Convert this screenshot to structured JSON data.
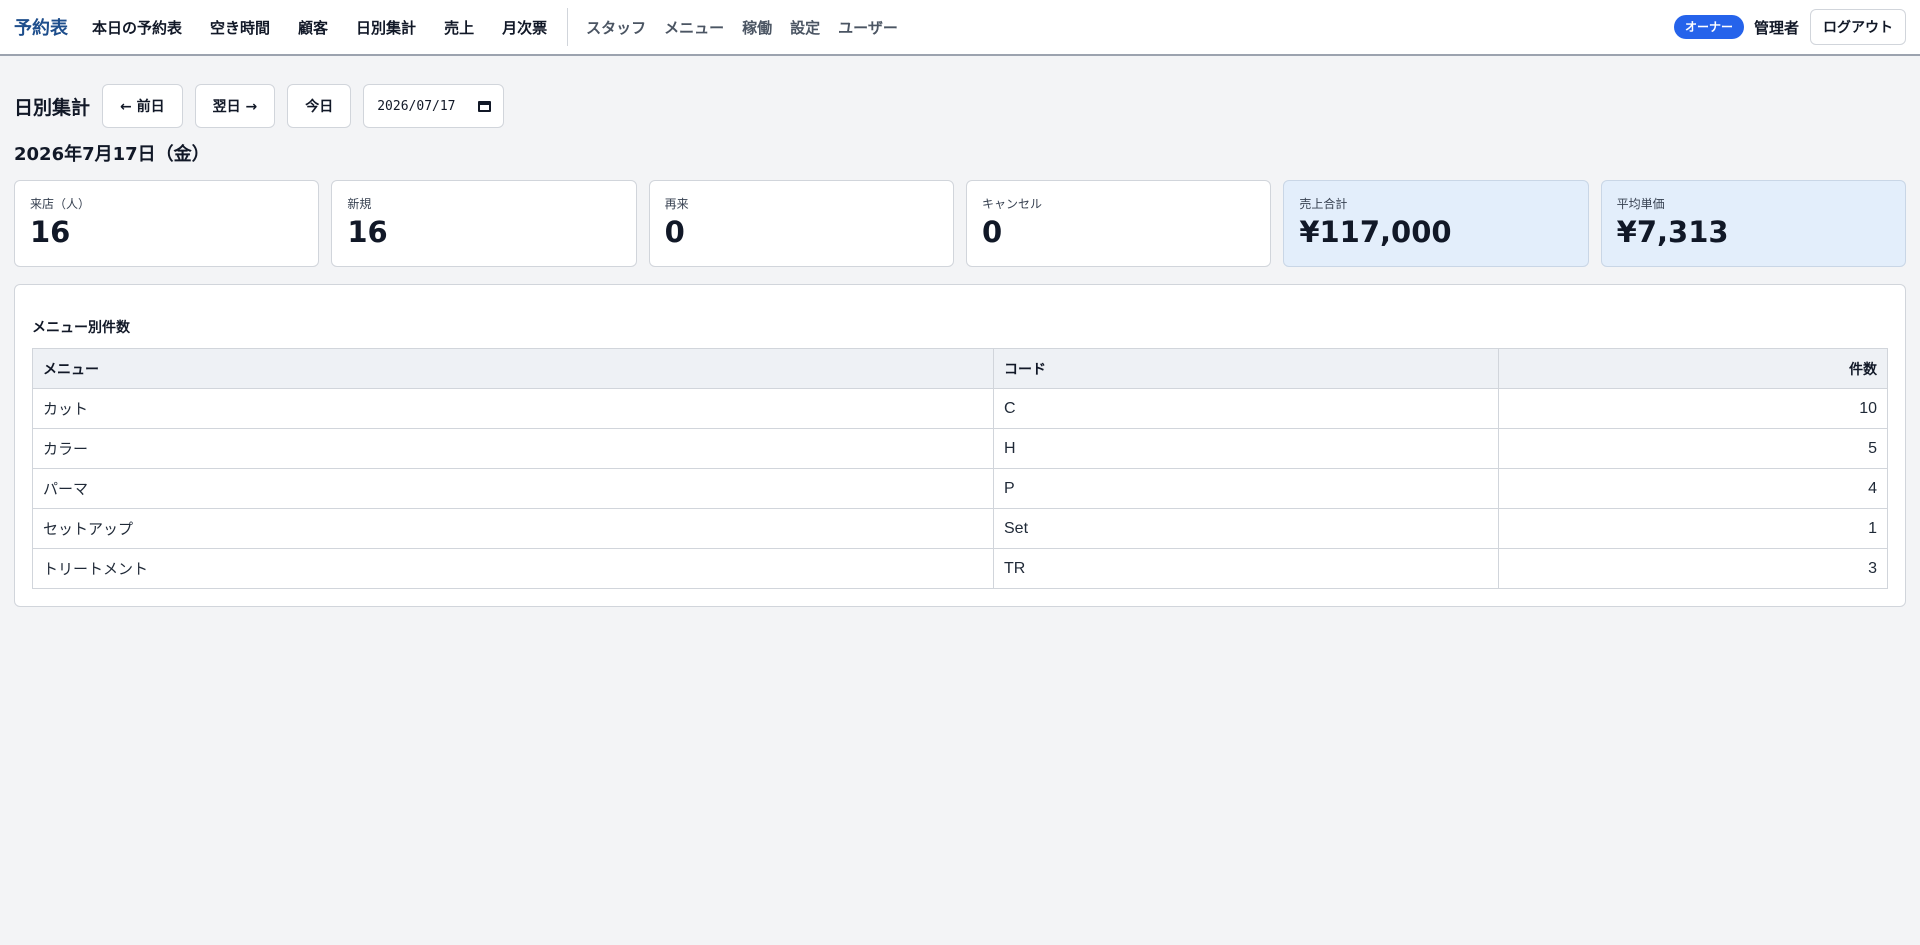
{
  "nav": {
    "brand": "予約表",
    "main_items": [
      {
        "label": "本日の予約表"
      },
      {
        "label": "空き時間"
      },
      {
        "label": "顧客"
      },
      {
        "label": "日別集計"
      },
      {
        "label": "売上"
      },
      {
        "label": "月次票"
      }
    ],
    "admin_items": [
      {
        "label": "スタッフ"
      },
      {
        "label": "メニュー"
      },
      {
        "label": "稼働"
      },
      {
        "label": "設定"
      },
      {
        "label": "ユーザー"
      }
    ],
    "role_badge": "オーナー",
    "user_name": "管理者",
    "logout_label": "ログアウト"
  },
  "toolbar": {
    "title": "日別集計",
    "prev_label": "← 前日",
    "next_label": "翌日 →",
    "today_label": "今日",
    "date_value": "2026/07/17"
  },
  "date_heading": "2026年7月17日（金）",
  "stats": [
    {
      "label": "来店（人）",
      "value": "16"
    },
    {
      "label": "新規",
      "value": "16"
    },
    {
      "label": "再来",
      "value": "0"
    },
    {
      "label": "キャンセル",
      "value": "0"
    },
    {
      "label": "売上合計",
      "value": "¥117,000"
    },
    {
      "label": "平均単価",
      "value": "¥7,313"
    }
  ],
  "menu_table": {
    "title": "メニュー別件数",
    "headers": {
      "menu": "メニュー",
      "code": "コード",
      "count": "件数"
    },
    "rows": [
      {
        "menu": "カット",
        "code": "C",
        "count": "10"
      },
      {
        "menu": "カラー",
        "code": "H",
        "count": "5"
      },
      {
        "menu": "パーマ",
        "code": "P",
        "count": "4"
      },
      {
        "menu": "セットアップ",
        "code": "Set",
        "count": "1"
      },
      {
        "menu": "トリートメント",
        "code": "TR",
        "count": "3"
      }
    ]
  },
  "colors": {
    "brand": "#1e4e8c",
    "badge": "#2563eb",
    "highlight_card": "#e3eefb"
  }
}
